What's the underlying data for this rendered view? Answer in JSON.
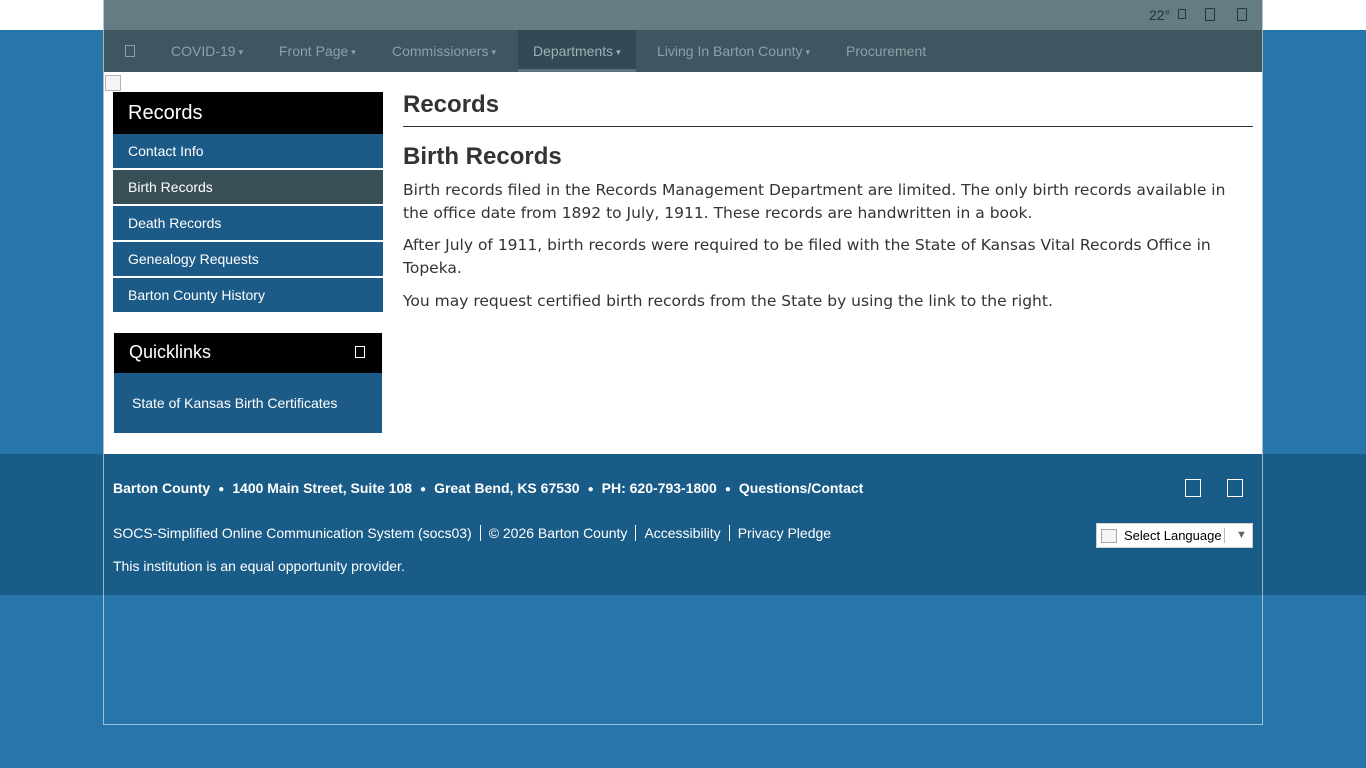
{
  "utility": {
    "temperature": "22°"
  },
  "nav": {
    "items": [
      {
        "label": "COVID-19",
        "caret": "▾"
      },
      {
        "label": "Front Page",
        "caret": "▾"
      },
      {
        "label": "Commissioners",
        "caret": "▾"
      },
      {
        "label": "Departments",
        "caret": "▾"
      },
      {
        "label": "Living In Barton County",
        "caret": "▾"
      },
      {
        "label": "Procurement"
      }
    ],
    "active": "Departments"
  },
  "sidebar": {
    "title": "Records",
    "items": [
      {
        "label": "Contact Info"
      },
      {
        "label": "Birth Records"
      },
      {
        "label": "Death Records"
      },
      {
        "label": "Genealogy Requests"
      },
      {
        "label": "Barton County History"
      }
    ],
    "active": "Birth Records"
  },
  "quicklinks": {
    "title": "Quicklinks",
    "links": [
      "State of Kansas Birth Certificates"
    ]
  },
  "main": {
    "title": "Records",
    "subtitle": "Birth Records",
    "paragraphs": [
      "Birth records filed in the Records Management Department are limited.  The only birth records available in the office date from 1892 to July, 1911.  These records are handwritten in a book.",
      "After July of 1911, birth records were required to be filed with the State of Kansas Vital Records Office in Topeka.",
      "You may request certified birth records from the State by using the link to the right."
    ]
  },
  "footer": {
    "name": "Barton County",
    "address": "1400 Main Street, Suite 108",
    "city": "Great Bend, KS  67530",
    "phone": "PH: 620-793-1800",
    "contact": "Questions/Contact",
    "socs_alt": "SOCS-Simplified Online Communication System (socs03)",
    "copyright": "© 2026 Barton County",
    "accessibility": "Accessibility",
    "privacy": "Privacy Pledge",
    "equal": "This institution is an equal opportunity provider.",
    "language": "Select Language"
  },
  "colors": {
    "background": "#2775ab",
    "nav_bar": "#3f5560",
    "sidebar_item": "#1c5b88",
    "sidebar_active": "#384f57",
    "footer": "#1a5c88"
  }
}
